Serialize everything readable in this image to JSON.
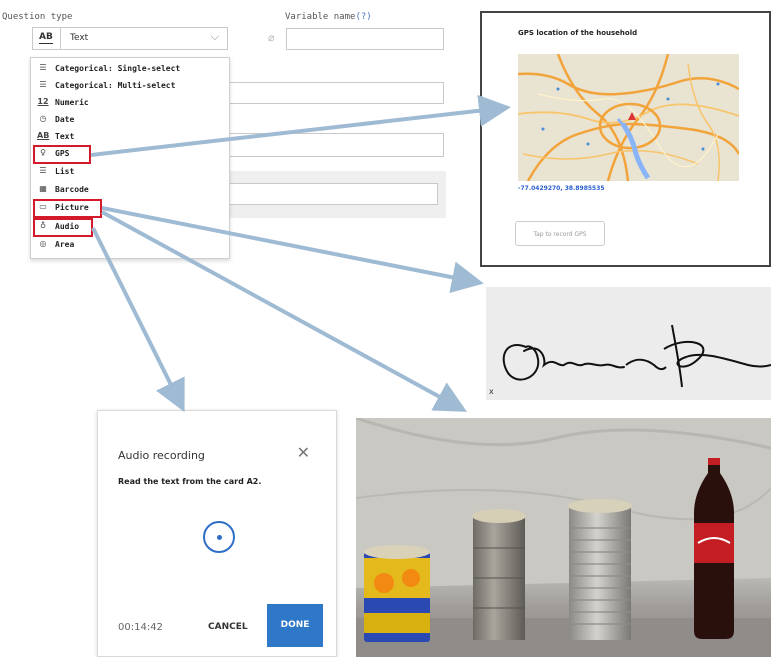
{
  "designer": {
    "question_type_label": "Question type",
    "variable_name_label": "Variable name",
    "help_marker": "(?)",
    "selected_type_icon": "AB",
    "selected_type": "Text",
    "menu": [
      {
        "icon": "list-icon",
        "glyph": "☰",
        "label": "Categorical: Single-select"
      },
      {
        "icon": "list-icon",
        "glyph": "☰",
        "label": "Categorical: Multi-select"
      },
      {
        "icon": "numeric-icon",
        "glyph": "12",
        "label": "Numeric"
      },
      {
        "icon": "clock-icon",
        "glyph": "◷",
        "label": "Date"
      },
      {
        "icon": "text-icon",
        "glyph": "AB",
        "label": "Text"
      },
      {
        "icon": "person-pin-icon",
        "glyph": "♀",
        "label": "GPS"
      },
      {
        "icon": "list-icon",
        "glyph": "☰",
        "label": "List"
      },
      {
        "icon": "barcode-icon",
        "glyph": "▦",
        "label": "Barcode"
      },
      {
        "icon": "picture-icon",
        "glyph": "▭",
        "label": "Picture"
      },
      {
        "icon": "microphone-icon",
        "glyph": "♁",
        "label": "Audio"
      },
      {
        "icon": "area-icon",
        "glyph": "◎",
        "label": "Area"
      }
    ]
  },
  "gps": {
    "title": "GPS location of the household",
    "coords": "-77.0429270, 38.8985535",
    "button": "Tap to record GPS"
  },
  "signature": {
    "x": "x"
  },
  "audio": {
    "title": "Audio recording",
    "close_icon": "close-icon",
    "instruction": "Read the text from the card A2.",
    "timer": "00:14:42",
    "cancel": "CANCEL",
    "done": "DONE"
  },
  "colors": {
    "highlight": "#d41a2a",
    "arrow": "#9fbbd4",
    "accent": "#2f78c8"
  }
}
